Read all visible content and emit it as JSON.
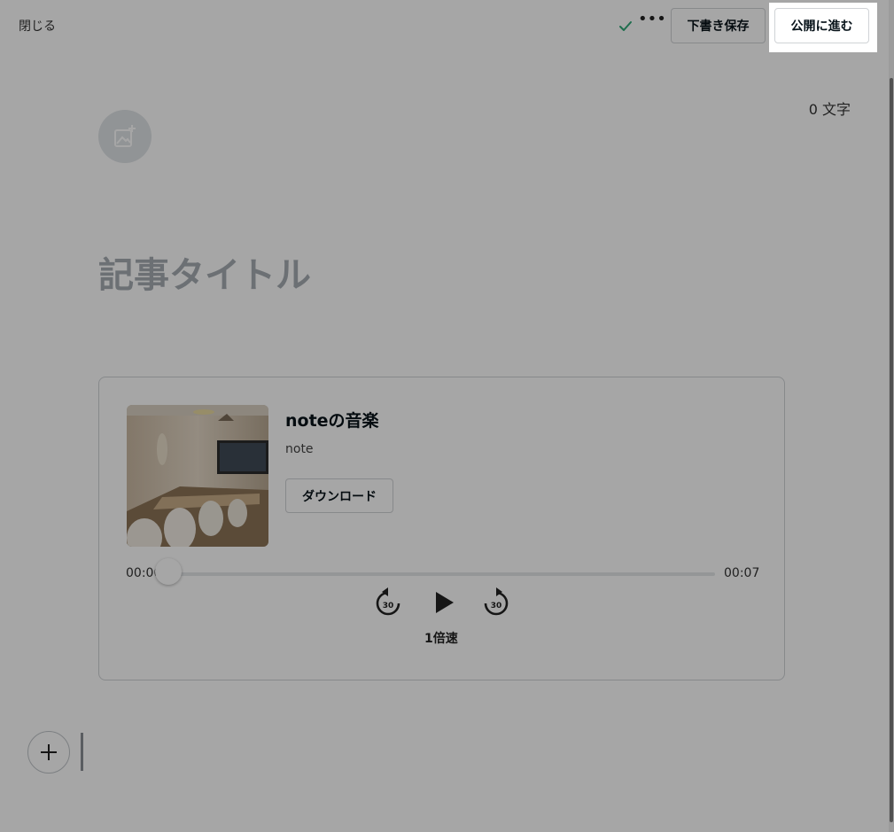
{
  "header": {
    "close_label": "閉じる",
    "more_label": "•••",
    "save_draft_label": "下書き保存",
    "publish_label": "公開に進む"
  },
  "editor": {
    "char_count": "0 文字",
    "title_placeholder": "記事タイトル"
  },
  "audio": {
    "title": "noteの音楽",
    "author": "note",
    "download_label": "ダウンロード",
    "current_time": "00:00",
    "total_time": "00:07",
    "progress": 0,
    "rewind_seconds": "30",
    "forward_seconds": "30",
    "speed_label": "1倍速"
  },
  "colors": {
    "check": "#2fa877",
    "overlay": "rgba(0,0,0,0.35)"
  },
  "icons": [
    "check-icon",
    "more-icon",
    "add-image-icon",
    "rewind-30-icon",
    "play-icon",
    "forward-30-icon",
    "plus-icon"
  ]
}
